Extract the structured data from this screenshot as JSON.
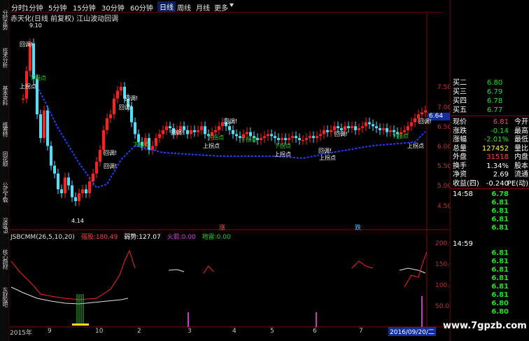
{
  "sidebar": {
    "tabs": [
      "分时走势",
      "技术分析",
      "基本资料",
      "维赛特",
      "同花顺",
      "公式下载",
      "深度F9",
      "核心题材",
      "东财股吧"
    ]
  },
  "periods": [
    "分时",
    "1分钟",
    "5分钟",
    "15分钟",
    "30分钟",
    "60分钟",
    "日线",
    "周线",
    "月线",
    "更多"
  ],
  "active_period": "日线",
  "chart_title": "赤天化(日线 前复权) 江山波动回调",
  "price_axis": [
    "7.50",
    "7.00",
    "6.50",
    "6.00",
    "5.50",
    "5.00",
    "4.50"
  ],
  "current_price_tag": "6.64",
  "high_label": "9.10",
  "low_label": "4.14",
  "annotations": {
    "pullback": "回调!",
    "down_inflection": "下拐点",
    "up_inflection": "上拐点",
    "rise": "涨",
    "fall": "跌"
  },
  "indicator": {
    "name": "JSBCMM(26,5,10,20)",
    "items": [
      {
        "label": "强股:",
        "value": "180.49",
        "color": "#ff4040"
      },
      {
        "label": "弱势:",
        "value": "127.07",
        "color": "#ffffff"
      },
      {
        "label": "火箭:",
        "value": "0.00",
        "color": "#e040e0"
      },
      {
        "label": "地雷:",
        "value": "0.00",
        "color": "#20d020"
      }
    ],
    "axis": [
      "200.0",
      "150.0",
      "100.0",
      "50.0"
    ]
  },
  "x_axis": [
    "2015年",
    "9",
    "10",
    "2",
    "3",
    "4",
    "5",
    "6",
    "7",
    "8"
  ],
  "date_tag": "2016/09/20/二",
  "watermark": "www.7gpzb.com",
  "quotes": {
    "asks": [
      {
        "label": "买二",
        "value": "6.80"
      },
      {
        "label": "买三",
        "value": "6.79"
      },
      {
        "label": "买四",
        "value": "6.78"
      },
      {
        "label": "买五",
        "value": "6.77"
      }
    ],
    "stats": [
      {
        "label": "现价",
        "value": "6.81",
        "label2": "今开",
        "color": "#ff4040"
      },
      {
        "label": "涨跌",
        "value": "-0.14",
        "label2": "最高",
        "color": "#20e020"
      },
      {
        "label": "涨幅",
        "value": "-2.01%",
        "label2": "最低",
        "color": "#20e020"
      },
      {
        "label": "总量",
        "value": "127452",
        "label2": "量比",
        "color": "#ffff40"
      },
      {
        "label": "外盘",
        "value": "31518",
        "label2": "内盘",
        "color": "#ff4040"
      },
      {
        "label": "换手",
        "value": "1.34%",
        "label2": "股本",
        "color": "#ffffff"
      },
      {
        "label": "净资",
        "value": "2.69",
        "label2": "流通",
        "color": "#ffffff"
      },
      {
        "label": "收益(四)",
        "value": "-0.240",
        "label2": "PE(动)",
        "color": "#ffffff"
      }
    ]
  },
  "ticks": {
    "group1_time": "14:58",
    "group1": [
      "6.78",
      "6.81",
      "6.81",
      "6.81",
      "6.81"
    ],
    "group2_time": "14:59",
    "group2": [
      "6.81",
      "6.81",
      "6.81",
      "6.81",
      "6.81",
      "6.81",
      "6.80",
      "6.80"
    ]
  },
  "colors": {
    "up": "#ff2020",
    "down": "#50e0ff",
    "trend": "#2040ff",
    "frame": "#8a0000"
  }
}
